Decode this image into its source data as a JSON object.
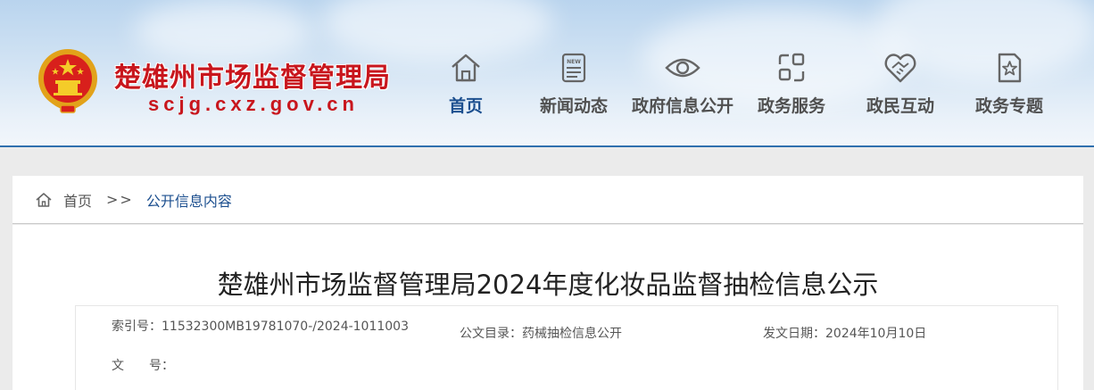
{
  "header": {
    "site_title": "楚雄州市场监督管理局",
    "site_domain": "scjg.cxz.gov.cn",
    "emblem_icon": "national-emblem-icon",
    "accent_color": "#c8161d",
    "nav_active_color": "#1c4f8f"
  },
  "nav": {
    "items": [
      {
        "label": "首页",
        "icon": "home-icon",
        "active": true
      },
      {
        "label": "新闻动态",
        "icon": "news-icon",
        "active": false
      },
      {
        "label": "政府信息公开",
        "icon": "eye-icon",
        "active": false
      },
      {
        "label": "政务服务",
        "icon": "service-icon",
        "active": false
      },
      {
        "label": "政民互动",
        "icon": "handshake-heart-icon",
        "active": false
      },
      {
        "label": "政务专题",
        "icon": "star-document-icon",
        "active": false
      }
    ]
  },
  "breadcrumb": {
    "home": "首页",
    "separator": ">>",
    "current": "公开信息内容"
  },
  "article": {
    "title": "楚雄州市场监督管理局2024年度化妆品监督抽检信息公示"
  },
  "meta": {
    "index_label": "索引号：",
    "index_value": "11532300MB19781070-/2024-1011003",
    "catalog_label": "公文目录：",
    "catalog_value": "药械抽检信息公开",
    "date_label": "发文日期：",
    "date_value": "2024年10月10日",
    "docno_label": "文　　号："
  }
}
